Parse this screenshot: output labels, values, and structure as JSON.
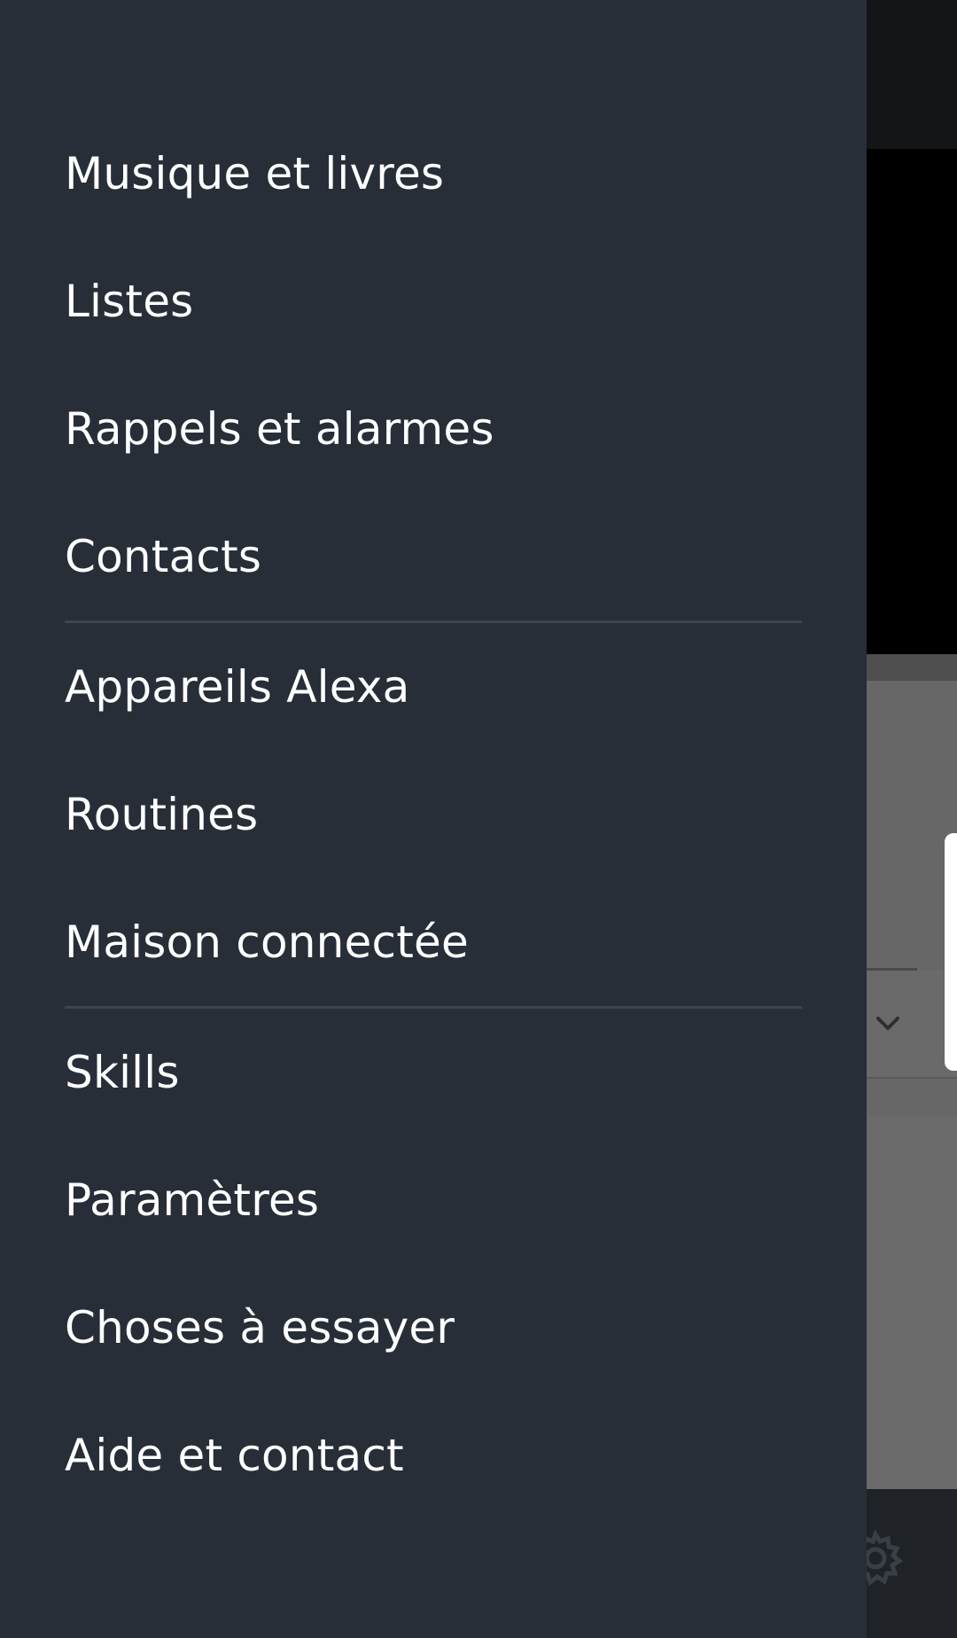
{
  "drawer": {
    "groups": [
      {
        "items": [
          {
            "label": "Musique et livres"
          },
          {
            "label": "Listes"
          },
          {
            "label": "Rappels et alarmes"
          },
          {
            "label": "Contacts"
          }
        ]
      },
      {
        "items": [
          {
            "label": "Appareils Alexa"
          },
          {
            "label": "Routines"
          },
          {
            "label": "Maison connectée"
          }
        ]
      },
      {
        "items": [
          {
            "label": "Skills"
          },
          {
            "label": "Paramètres"
          },
          {
            "label": "Choses à essayer"
          },
          {
            "label": "Aide et contact"
          }
        ]
      }
    ]
  },
  "background_app": {
    "icons": [
      "chevron-down-icon",
      "gear-icon"
    ]
  },
  "colors": {
    "drawer_background": "#272e38",
    "drawer_text": "#ffffff",
    "divider": "#3d4550",
    "scrim": "#5b5b5b"
  }
}
